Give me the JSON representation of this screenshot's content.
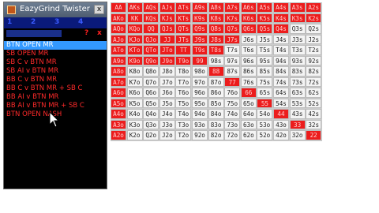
{
  "window": {
    "title": "EazyGrind Twister",
    "close_label": "x"
  },
  "toolbar": {
    "items": [
      "1",
      "2",
      "3",
      "4"
    ]
  },
  "subbar": {
    "help_label": "?",
    "close_label": "x"
  },
  "range_list": {
    "items": [
      {
        "label": "BTN OPEN MR",
        "selected": true
      },
      {
        "label": "SB OPEN MR",
        "selected": false
      },
      {
        "label": "SB C v BTN MR",
        "selected": false
      },
      {
        "label": "SB AI v BTN MR",
        "selected": false
      },
      {
        "label": "BB C v BTN MR",
        "selected": false
      },
      {
        "label": "BB C v BTN MR + SB C",
        "selected": false
      },
      {
        "label": "BB AI v BTN MR",
        "selected": false
      },
      {
        "label": "BB AI v BTN MR + SB C",
        "selected": false
      },
      {
        "label": "BTN OPEN NASH",
        "selected": false
      }
    ]
  },
  "colors": {
    "in_range": "#ec1c1c",
    "out_range": "#f4f4f4",
    "selected": "#3399ff",
    "list_text": "#ff2a2a"
  },
  "grid": {
    "rows": [
      [
        "AA",
        "AKs",
        "AQs",
        "AJs",
        "ATs",
        "A9s",
        "A8s",
        "A7s",
        "A6s",
        "A5s",
        "A4s",
        "A3s",
        "A2s"
      ],
      [
        "AKo",
        "KK",
        "KQs",
        "KJs",
        "KTs",
        "K9s",
        "K8s",
        "K7s",
        "K6s",
        "K5s",
        "K4s",
        "K3s",
        "K2s"
      ],
      [
        "AQo",
        "KQo",
        "QQ",
        "QJs",
        "QTs",
        "Q9s",
        "Q8s",
        "Q7s",
        "Q6s",
        "Q5s",
        "Q4s",
        "Q3s",
        "Q2s"
      ],
      [
        "AJo",
        "KJo",
        "QJo",
        "JJ",
        "JTs",
        "J9s",
        "J8s",
        "J7s",
        "J6s",
        "J5s",
        "J4s",
        "J3s",
        "J2s"
      ],
      [
        "ATo",
        "KTo",
        "QTo",
        "JTo",
        "TT",
        "T9s",
        "T8s",
        "T7s",
        "T6s",
        "T5s",
        "T4s",
        "T3s",
        "T2s"
      ],
      [
        "A9o",
        "K9o",
        "Q9o",
        "J9o",
        "T9o",
        "99",
        "98s",
        "97s",
        "96s",
        "95s",
        "94s",
        "93s",
        "92s"
      ],
      [
        "A8o",
        "K8o",
        "Q8o",
        "J8o",
        "T8o",
        "98o",
        "88",
        "87s",
        "86s",
        "85s",
        "84s",
        "83s",
        "82s"
      ],
      [
        "A7o",
        "K7o",
        "Q7o",
        "J7o",
        "T7o",
        "97o",
        "87o",
        "77",
        "76s",
        "75s",
        "74s",
        "73s",
        "72s"
      ],
      [
        "A6o",
        "K6o",
        "Q6o",
        "J6o",
        "T6o",
        "96o",
        "86o",
        "76o",
        "66",
        "65s",
        "64s",
        "63s",
        "62s"
      ],
      [
        "A5o",
        "K5o",
        "Q5o",
        "J5o",
        "T5o",
        "95o",
        "85o",
        "75o",
        "65o",
        "55",
        "54s",
        "53s",
        "52s"
      ],
      [
        "A4o",
        "K4o",
        "Q4o",
        "J4o",
        "T4o",
        "94o",
        "84o",
        "74o",
        "64o",
        "54o",
        "44",
        "43s",
        "42s"
      ],
      [
        "A3o",
        "K3o",
        "Q3o",
        "J3o",
        "T3o",
        "93o",
        "83o",
        "73o",
        "63o",
        "53o",
        "43o",
        "33",
        "32s"
      ],
      [
        "A2o",
        "K2o",
        "Q2o",
        "J2o",
        "T2o",
        "92o",
        "82o",
        "72o",
        "62o",
        "52o",
        "42o",
        "32o",
        "22"
      ]
    ],
    "in_range": [
      [
        1,
        1,
        1,
        1,
        1,
        1,
        1,
        1,
        1,
        1,
        1,
        1,
        1
      ],
      [
        1,
        1,
        1,
        1,
        1,
        1,
        1,
        1,
        1,
        1,
        1,
        1,
        1
      ],
      [
        1,
        1,
        1,
        1,
        1,
        1,
        1,
        1,
        1,
        1,
        1,
        0,
        0
      ],
      [
        1,
        1,
        1,
        1,
        1,
        1,
        1,
        1,
        0,
        0,
        0,
        0,
        0
      ],
      [
        1,
        1,
        1,
        1,
        1,
        1,
        1,
        0,
        0,
        0,
        0,
        0,
        0
      ],
      [
        1,
        1,
        1,
        1,
        1,
        1,
        0,
        0,
        0,
        0,
        0,
        0,
        0
      ],
      [
        1,
        0,
        0,
        0,
        0,
        0,
        1,
        0,
        0,
        0,
        0,
        0,
        0
      ],
      [
        1,
        0,
        0,
        0,
        0,
        0,
        0,
        1,
        0,
        0,
        0,
        0,
        0
      ],
      [
        1,
        0,
        0,
        0,
        0,
        0,
        0,
        0,
        1,
        0,
        0,
        0,
        0
      ],
      [
        1,
        0,
        0,
        0,
        0,
        0,
        0,
        0,
        0,
        1,
        0,
        0,
        0
      ],
      [
        1,
        0,
        0,
        0,
        0,
        0,
        0,
        0,
        0,
        0,
        1,
        0,
        0
      ],
      [
        1,
        0,
        0,
        0,
        0,
        0,
        0,
        0,
        0,
        0,
        0,
        1,
        0
      ],
      [
        1,
        0,
        0,
        0,
        0,
        0,
        0,
        0,
        0,
        0,
        0,
        0,
        1
      ]
    ]
  }
}
